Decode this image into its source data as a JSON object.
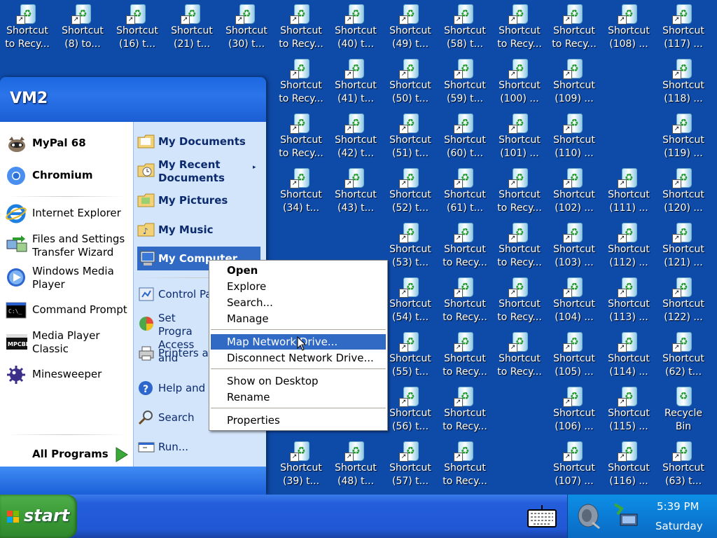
{
  "desktop": {
    "icons": [
      {
        "label": "Shortcut to Recy...",
        "col": 0,
        "row": 0
      },
      {
        "label": "Shortcut (8) to...",
        "col": 1,
        "row": 0
      },
      {
        "label": "Shortcut (16) t...",
        "col": 2,
        "row": 0
      },
      {
        "label": "Shortcut (21) t...",
        "col": 3,
        "row": 0
      },
      {
        "label": "Shortcut (30) t...",
        "col": 4,
        "row": 0
      },
      {
        "label": "Shortcut to Recy...",
        "col": 5,
        "row": 0
      },
      {
        "label": "Shortcut (40) t...",
        "col": 6,
        "row": 0
      },
      {
        "label": "Shortcut (49) t...",
        "col": 7,
        "row": 0
      },
      {
        "label": "Shortcut (58) t...",
        "col": 8,
        "row": 0
      },
      {
        "label": "Shortcut to Recy...",
        "col": 9,
        "row": 0
      },
      {
        "label": "Shortcut to Recy...",
        "col": 10,
        "row": 0
      },
      {
        "label": "Shortcut (108) ...",
        "col": 11,
        "row": 0
      },
      {
        "label": "Shortcut (117) ...",
        "col": 12,
        "row": 0
      },
      {
        "label": "Shortcut to Recy...",
        "col": 5,
        "row": 1
      },
      {
        "label": "Shortcut (41) t...",
        "col": 6,
        "row": 1
      },
      {
        "label": "Shortcut (50) t...",
        "col": 7,
        "row": 1
      },
      {
        "label": "Shortcut (59) t...",
        "col": 8,
        "row": 1
      },
      {
        "label": "Shortcut (100) ...",
        "col": 9,
        "row": 1
      },
      {
        "label": "Shortcut (109) ...",
        "col": 10,
        "row": 1
      },
      {
        "label": "Shortcut (118) ...",
        "col": 12,
        "row": 1
      },
      {
        "label": "Shortcut to Recy...",
        "col": 5,
        "row": 2
      },
      {
        "label": "Shortcut (42) t...",
        "col": 6,
        "row": 2
      },
      {
        "label": "Shortcut (51) t...",
        "col": 7,
        "row": 2
      },
      {
        "label": "Shortcut (60) t...",
        "col": 8,
        "row": 2
      },
      {
        "label": "Shortcut (101) ...",
        "col": 9,
        "row": 2
      },
      {
        "label": "Shortcut (110) ...",
        "col": 10,
        "row": 2
      },
      {
        "label": "Shortcut (119) ...",
        "col": 12,
        "row": 2
      },
      {
        "label": "Shortcut (34) t...",
        "col": 5,
        "row": 3
      },
      {
        "label": "Shortcut (43) t...",
        "col": 6,
        "row": 3
      },
      {
        "label": "Shortcut (52) t...",
        "col": 7,
        "row": 3
      },
      {
        "label": "Shortcut (61) t...",
        "col": 8,
        "row": 3
      },
      {
        "label": "Shortcut to Recy...",
        "col": 9,
        "row": 3
      },
      {
        "label": "Shortcut (102) ...",
        "col": 10,
        "row": 3
      },
      {
        "label": "Shortcut (111) ...",
        "col": 11,
        "row": 3
      },
      {
        "label": "Shortcut (120) ...",
        "col": 12,
        "row": 3
      },
      {
        "label": "Shortcut (53) t...",
        "col": 7,
        "row": 4
      },
      {
        "label": "Shortcut to Recy...",
        "col": 8,
        "row": 4
      },
      {
        "label": "Shortcut to Recy...",
        "col": 9,
        "row": 4
      },
      {
        "label": "Shortcut (103) ...",
        "col": 10,
        "row": 4
      },
      {
        "label": "Shortcut (112) ...",
        "col": 11,
        "row": 4
      },
      {
        "label": "Shortcut (121) ...",
        "col": 12,
        "row": 4
      },
      {
        "label": "Shortcut (54) t...",
        "col": 7,
        "row": 5
      },
      {
        "label": "Shortcut to Recy...",
        "col": 8,
        "row": 5
      },
      {
        "label": "Shortcut to Recy...",
        "col": 9,
        "row": 5
      },
      {
        "label": "Shortcut (104) ...",
        "col": 10,
        "row": 5
      },
      {
        "label": "Shortcut (113) ...",
        "col": 11,
        "row": 5
      },
      {
        "label": "Shortcut (122) ...",
        "col": 12,
        "row": 5
      },
      {
        "label": "Shortcut (55) t...",
        "col": 7,
        "row": 6
      },
      {
        "label": "Shortcut to Recy...",
        "col": 8,
        "row": 6
      },
      {
        "label": "Shortcut to Recy...",
        "col": 9,
        "row": 6
      },
      {
        "label": "Shortcut (105) ...",
        "col": 10,
        "row": 6
      },
      {
        "label": "Shortcut (114) ...",
        "col": 11,
        "row": 6
      },
      {
        "label": "Shortcut (62) t...",
        "col": 12,
        "row": 6
      },
      {
        "label": "Shortcut (56) t...",
        "col": 7,
        "row": 7
      },
      {
        "label": "Shortcut to Recy...",
        "col": 8,
        "row": 7
      },
      {
        "label": "Shortcut (106) ...",
        "col": 10,
        "row": 7
      },
      {
        "label": "Shortcut (115) ...",
        "col": 11,
        "row": 7
      },
      {
        "label": "Recycle Bin",
        "col": 12,
        "row": 7
      },
      {
        "label": "Shortcut (39) t...",
        "col": 5,
        "row": 8
      },
      {
        "label": "Shortcut (48) t...",
        "col": 6,
        "row": 8
      },
      {
        "label": "Shortcut (57) t...",
        "col": 7,
        "row": 8
      },
      {
        "label": "Shortcut to Recy...",
        "col": 8,
        "row": 8
      },
      {
        "label": "Shortcut (107) ...",
        "col": 10,
        "row": 8
      },
      {
        "label": "Shortcut (116) ...",
        "col": 11,
        "row": 8
      },
      {
        "label": "Shortcut (63) t...",
        "col": 12,
        "row": 8
      }
    ]
  },
  "start_menu": {
    "user": "VM2",
    "pinned": [
      "MyPal 68",
      "Chromium"
    ],
    "recent": [
      "Internet Explorer",
      "Files and Settings Transfer Wizard",
      "Windows Media Player",
      "Command Prompt",
      "Media Player Classic",
      "Minesweeper"
    ],
    "all_programs": "All Programs",
    "right": [
      "My Documents",
      "My Recent Documents",
      "My Pictures",
      "My Music",
      "My Computer",
      "Control Pa",
      "Set Progra Access and",
      "Printers ar",
      "Help and S",
      "Search",
      "Run..."
    ]
  },
  "context_menu": {
    "items": [
      "Open",
      "Explore",
      "Search...",
      "Manage",
      "Map Network Drive...",
      "Disconnect Network Drive...",
      "Show on Desktop",
      "Rename",
      "Properties"
    ],
    "highlighted": "Map Network Drive..."
  },
  "taskbar": {
    "start_label": "start",
    "time": "5:39 PM",
    "day": "Saturday"
  },
  "colors": {
    "desktop": "#0e4aa8",
    "selection": "#316ac5",
    "start_green": "#3a9b36"
  }
}
